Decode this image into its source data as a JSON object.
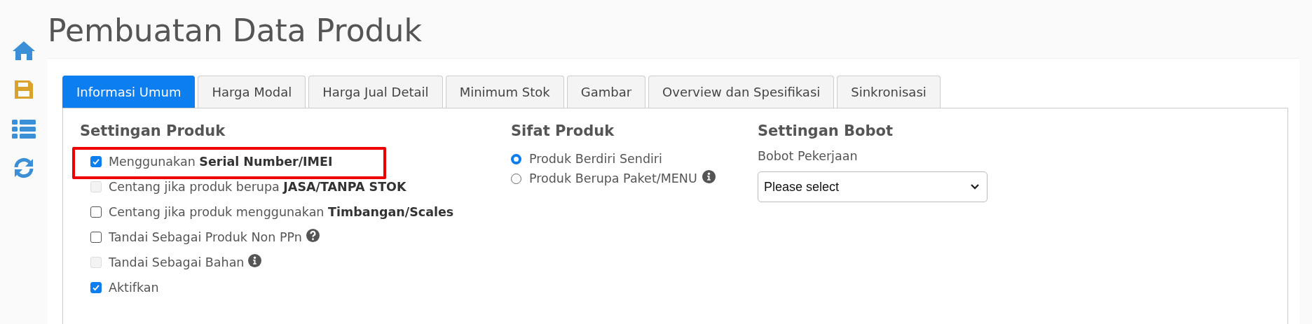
{
  "page_title": "Pembuatan Data Produk",
  "sidebar": [
    {
      "kind": "home"
    },
    {
      "kind": "save"
    },
    {
      "kind": "list"
    },
    {
      "kind": "sync"
    }
  ],
  "tabs": [
    {
      "label": "Informasi Umum",
      "selected": true
    },
    {
      "label": "Harga Modal",
      "selected": false
    },
    {
      "label": "Harga Jual Detail",
      "selected": false
    },
    {
      "label": "Minimum Stok",
      "selected": false
    },
    {
      "label": "Gambar",
      "selected": false
    },
    {
      "label": "Overview dan Spesifikasi",
      "selected": false
    },
    {
      "label": "Sinkronisasi",
      "selected": false
    }
  ],
  "settingan_produk": {
    "heading": "Settingan Produk",
    "options": [
      {
        "label": "Menggunakan **Serial Number/IMEI**",
        "checked": true,
        "disabled": false,
        "highlighted": true,
        "kind": "plain"
      },
      {
        "label": "Centang jika produk berupa **JASA/TANPA STOK**",
        "checked": false,
        "disabled": true,
        "highlighted": false,
        "kind": "plain"
      },
      {
        "label": "Centang jika produk menggunakan **Timbangan/Scales**",
        "checked": false,
        "disabled": false,
        "highlighted": false,
        "kind": "plain"
      },
      {
        "label": "Tandai Sebagai Produk Non PPn",
        "checked": false,
        "disabled": false,
        "highlighted": false,
        "kind": "question"
      },
      {
        "label": "Tandai Sebagai Bahan",
        "checked": false,
        "disabled": true,
        "highlighted": false,
        "kind": "info"
      },
      {
        "label": "Aktifkan",
        "checked": true,
        "disabled": false,
        "highlighted": false,
        "kind": "plain"
      }
    ]
  },
  "sifat_produk": {
    "heading": "Sifat Produk",
    "options": [
      {
        "label": "Produk Berdiri Sendiri",
        "selected": true,
        "kind": "plain"
      },
      {
        "label": "Produk Berupa Paket/MENU",
        "selected": false,
        "kind": "info"
      }
    ]
  },
  "settingan_bobot": {
    "heading": "Settingan Bobot",
    "field_label": "Bobot Pekerjaan",
    "select_value": "Please select"
  }
}
